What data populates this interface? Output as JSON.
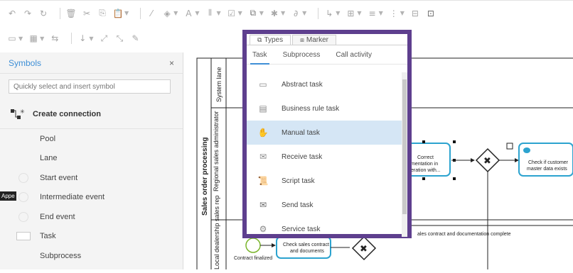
{
  "toolbar": {
    "row1": [
      "undo-icon",
      "redo-icon",
      "refresh-icon",
      "delete-icon",
      "cut-icon",
      "copy-icon",
      "paste-icon",
      "line-color-icon",
      "fill-color-icon",
      "text-color-icon",
      "align-icon",
      "arrange-icon",
      "types-icon",
      "more-icon",
      "link-icon",
      "connector-icon",
      "size-icon",
      "distribute-icon",
      "group-icon",
      "bring-front-icon",
      "image-icon"
    ],
    "row2": [
      "frame-icon",
      "table-icon",
      "arrow-icon",
      "down-icon",
      "expand-icon",
      "collapse-icon",
      "eraser-icon"
    ]
  },
  "sidebar": {
    "title": "Symbols",
    "close": "×",
    "search_placeholder": "Quickly select and insert symbol",
    "create_connection": "Create connection",
    "items": [
      {
        "label": "Pool",
        "icon": "none"
      },
      {
        "label": "Lane",
        "icon": "none"
      },
      {
        "label": "Start event",
        "icon": "circle"
      },
      {
        "label": "Intermediate event",
        "icon": "circle"
      },
      {
        "label": "End event",
        "icon": "circle"
      },
      {
        "label": "Task",
        "icon": "rect"
      },
      {
        "label": "Subprocess",
        "icon": "none"
      }
    ],
    "drag_tag": "Appe"
  },
  "popup": {
    "tabs": [
      {
        "label": "Types",
        "icon": "types-icon",
        "active": true
      },
      {
        "label": "Marker",
        "icon": "marker-icon",
        "active": false
      }
    ],
    "subtabs": [
      {
        "label": "Task",
        "active": true
      },
      {
        "label": "Subprocess",
        "active": false
      },
      {
        "label": "Call activity",
        "active": false
      }
    ],
    "items": [
      {
        "label": "Abstract task",
        "icon": "abstract-task-icon",
        "selected": false
      },
      {
        "label": "Business rule task",
        "icon": "business-rule-icon",
        "selected": false
      },
      {
        "label": "Manual task",
        "icon": "manual-task-icon",
        "selected": true
      },
      {
        "label": "Receive task",
        "icon": "receive-task-icon",
        "selected": false
      },
      {
        "label": "Script task",
        "icon": "script-task-icon",
        "selected": false
      },
      {
        "label": "Send task",
        "icon": "send-task-icon",
        "selected": false
      },
      {
        "label": "Service task",
        "icon": "service-task-icon",
        "selected": false
      }
    ]
  },
  "diagram": {
    "pool_label": "Sales order processing",
    "lanes": [
      "System lane",
      "Regional sales administrator",
      "Local dealership sales rep"
    ],
    "task_correct": [
      "Correct",
      "mentation in",
      "eration with..."
    ],
    "task_check_master": [
      "Check if customer",
      "master data exists"
    ],
    "task_check_contract": [
      "Check sales contract",
      "and documents"
    ],
    "start_label": "Contract finalized",
    "flow_label": "ales contract and documentation complete"
  },
  "colors": {
    "accent": "#3e8fd6",
    "popup_border": "#5e3f8e",
    "task_border": "#2ca3cf",
    "start_event": "#7ab52c",
    "selected_row": "#d5e6f5"
  }
}
